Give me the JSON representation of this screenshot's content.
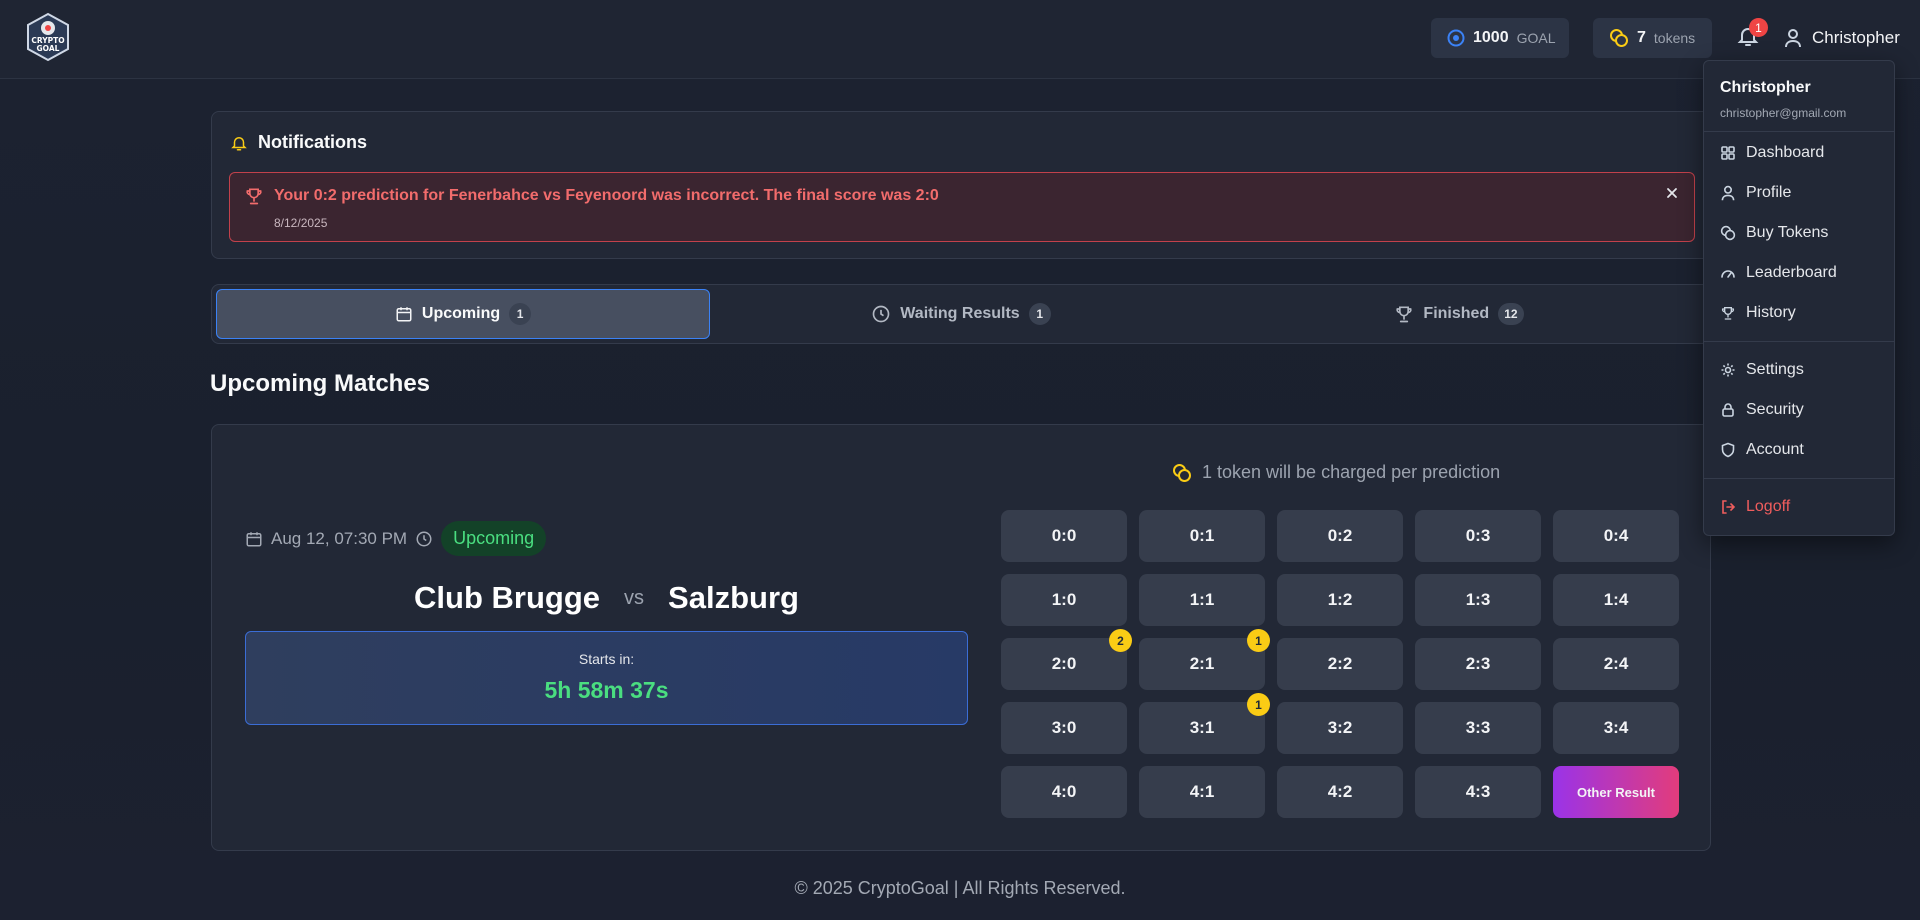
{
  "header": {
    "logo_text": "CRYPTO GOAL",
    "goal_balance": "1000",
    "goal_unit": "GOAL",
    "tokens_balance": "7",
    "tokens_unit": "tokens",
    "notification_count": "1",
    "username": "Christopher"
  },
  "notifications": {
    "title": "Notifications",
    "items": [
      {
        "message": "Your 0:2 prediction for Fenerbahce vs Feyenoord was incorrect. The final score was 2:0",
        "date": "8/12/2025"
      }
    ]
  },
  "tabs": [
    {
      "label": "Upcoming",
      "count": "1",
      "active": true
    },
    {
      "label": "Waiting Results",
      "count": "1",
      "active": false
    },
    {
      "label": "Finished",
      "count": "12",
      "active": false
    }
  ],
  "section_title": "Upcoming Matches",
  "match": {
    "charge_note": "1 token will be charged per prediction",
    "datetime": "Aug 12, 07:30 PM",
    "status": "Upcoming",
    "home_team": "Club Brugge",
    "vs": "vs",
    "away_team": "Salzburg",
    "countdown_label": "Starts in:",
    "countdown": "5h 58m 37s",
    "scores": [
      [
        "0:0",
        "0:1",
        "0:2",
        "0:3",
        "0:4"
      ],
      [
        "1:0",
        "1:1",
        "1:2",
        "1:3",
        "1:4"
      ],
      [
        "2:0",
        "2:1",
        "2:2",
        "2:3",
        "2:4"
      ],
      [
        "3:0",
        "3:1",
        "3:2",
        "3:3",
        "3:4"
      ],
      [
        "4:0",
        "4:1",
        "4:2",
        "4:3",
        "Other Result"
      ]
    ],
    "pick_counts": {
      "2:0": "2",
      "2:1": "1",
      "3:1": "1"
    }
  },
  "footer": "© 2025 CryptoGoal | All Rights Reserved.",
  "user_menu": {
    "name": "Christopher",
    "email": "christopher@gmail.com",
    "items": [
      "Dashboard",
      "Profile",
      "Buy Tokens",
      "Leaderboard",
      "History"
    ],
    "items2": [
      "Settings",
      "Security",
      "Account"
    ],
    "logoff": "Logoff"
  },
  "colors": {
    "accent_blue": "#3b82f6",
    "success_green": "#4ade80",
    "error_red": "#ef4444",
    "token_yellow": "#facc15"
  }
}
